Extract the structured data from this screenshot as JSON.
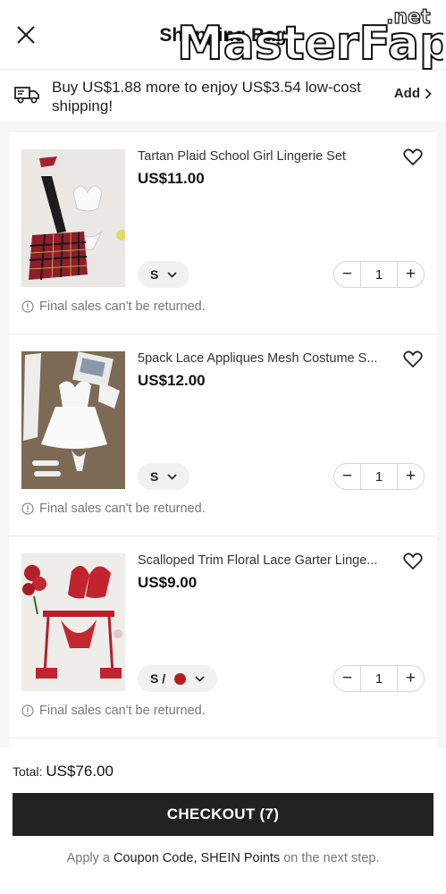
{
  "header": {
    "title": "Shopping Bag",
    "close_icon": "close-icon",
    "watermark_text": "MasterFap",
    "watermark_suffix": ".net"
  },
  "shipping": {
    "icon": "truck-icon",
    "text": "Buy US$1.88 more to enjoy US$3.54 low-cost shipping!",
    "add_label": "Add"
  },
  "items": [
    {
      "title": "Tartan Plaid School Girl Lingerie Set",
      "price": "US$11.00",
      "size": "S",
      "qty": "1",
      "note": "Final sales can't be returned."
    },
    {
      "title": "5pack Lace Appliques Mesh Costume S...",
      "price": "US$12.00",
      "size": "S",
      "qty": "1",
      "note": "Final sales can't be returned."
    },
    {
      "title": "Scalloped Trim Floral Lace Garter Linge...",
      "price": "US$9.00",
      "size": "S /",
      "qty": "1",
      "note": "Final sales can't be returned."
    }
  ],
  "colors": {
    "swatch_red": "#b51f1f",
    "watermark_pink": "#e0149b",
    "button_dark": "#222222"
  },
  "footer": {
    "total_label": "Total:",
    "total_value": "US$76.00",
    "checkout_label": "CHECKOUT (7)",
    "apply_prefix": "Apply a",
    "apply_link": "Coupon Code, SHEIN Points",
    "apply_suffix": "on the next step."
  }
}
